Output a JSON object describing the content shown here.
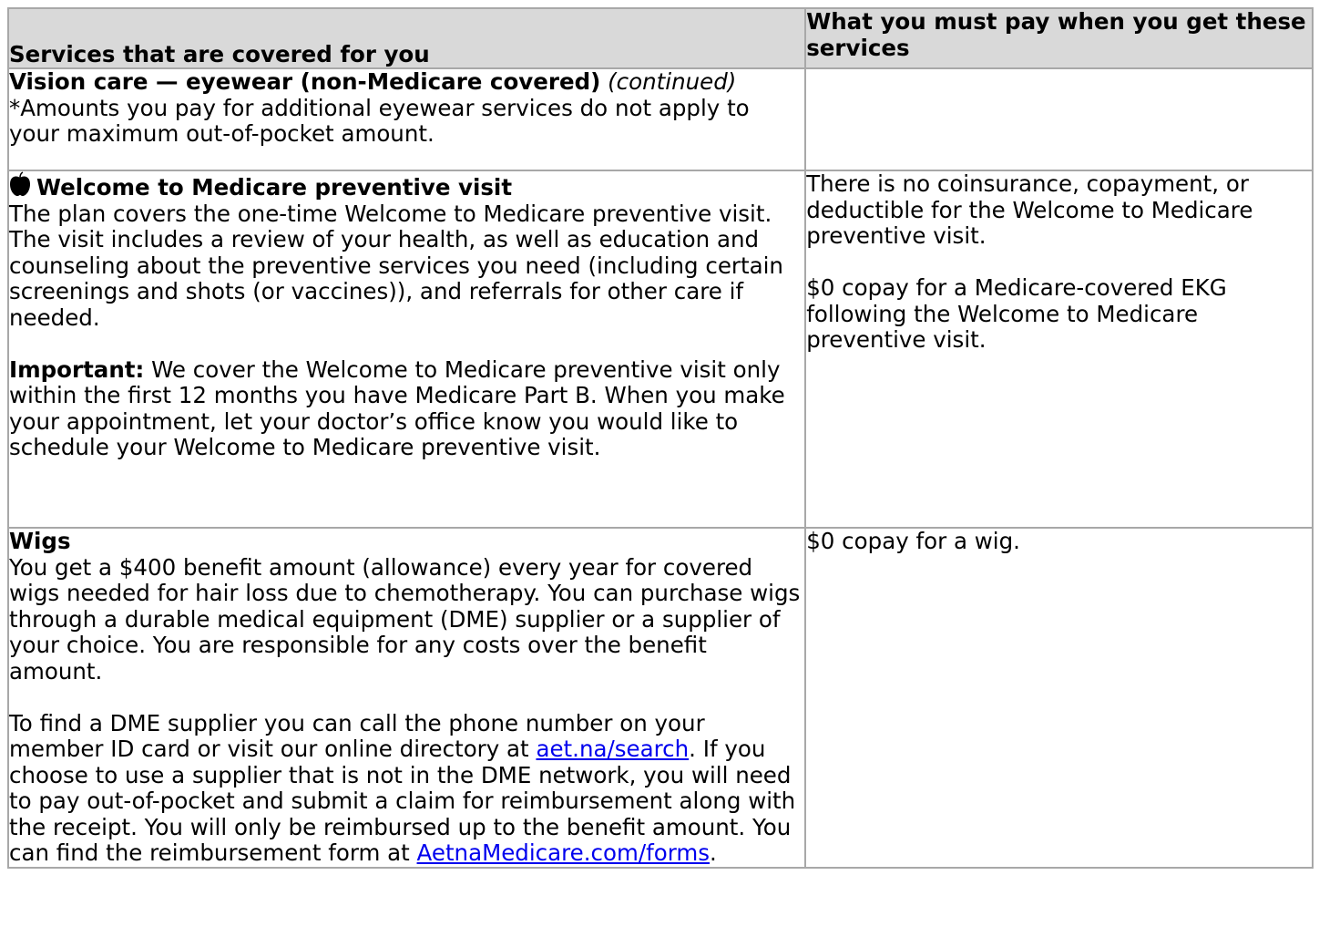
{
  "header": {
    "left": "Services that are covered for you",
    "right": "What you must pay when you get these services"
  },
  "vision": {
    "title": "Vision care — eyewear (non-Medicare covered)",
    "continued": "(continued)",
    "note": "*Amounts you pay for additional eyewear services do not apply to your maximum out-of-pocket amount."
  },
  "welcome": {
    "icon": "apple-icon",
    "title": "Welcome to Medicare preventive visit",
    "body": "The plan covers the one-time Welcome to Medicare preventive visit. The visit includes a review of your health, as well as education and counseling about the preventive services you need (including certain screenings and shots (or vaccines)), and referrals for other care if needed.",
    "important_label": "Important:",
    "important_text": " We cover the Welcome to Medicare preventive visit only within the first 12 months you have Medicare Part B. When you make your appointment, let your doctor’s office know you would like to schedule your Welcome to Medicare preventive visit.",
    "cost_1": "There is no coinsurance, copayment, or deductible for the Welcome to Medicare preventive visit.",
    "cost_2": "$0 copay for a Medicare-covered EKG following the Welcome to Medicare preventive visit."
  },
  "wigs": {
    "title": "Wigs",
    "body": "You get a $400 benefit amount (allowance) every year for covered wigs needed for hair loss due to chemotherapy. You can purchase wigs through a durable medical equipment (DME) supplier or a supplier of your choice. You are responsible for any costs over the benefit amount.",
    "find_before": "To find a DME supplier you can call the phone number on your member ID card or visit our online directory at ",
    "find_link": "aet.na/search",
    "find_after": ". If you choose to use a supplier that is not in the DME network, you will need to pay out-of-pocket and submit a claim for reimbursement along with the receipt. You will only be reimbursed up to the benefit amount. You can find the reimbursement form at ",
    "forms_link": "AetnaMedicare.com/forms",
    "forms_after": ".",
    "cost": "$0 copay for a wig."
  }
}
